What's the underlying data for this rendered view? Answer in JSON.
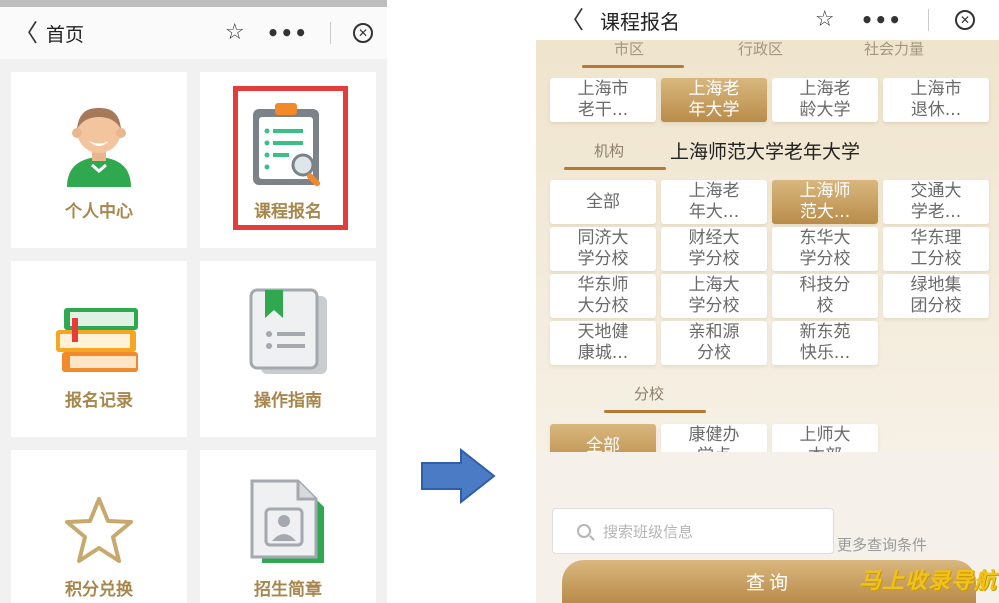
{
  "left": {
    "nav": {
      "back": "〈",
      "title": "首页",
      "star": "☆",
      "more": "•••",
      "close": "✕"
    },
    "tiles": [
      {
        "label": "个人中心",
        "icon": "person-avatar-icon"
      },
      {
        "label": "课程报名",
        "icon": "clipboard-search-icon",
        "highlighted": true
      },
      {
        "label": "报名记录",
        "icon": "book-stack-icon"
      },
      {
        "label": "操作指南",
        "icon": "bookmark-document-icon"
      },
      {
        "label": "积分兑换",
        "icon": "star-outline-icon"
      },
      {
        "label": "招生简章",
        "icon": "profile-document-icon"
      }
    ],
    "highlight_color": "#e43b3b",
    "label_color": "#a8874c"
  },
  "arrow_color": "#4a7bc4",
  "right": {
    "nav": {
      "back": "〈",
      "title": "课程报名",
      "star": "☆",
      "more": "•••",
      "close": "✕"
    },
    "category_tabs": [
      "市区",
      "行政区",
      "社会力量"
    ],
    "category_chips": [
      "上海市\n老干...",
      "上海老\n年大学",
      "上海老\n龄大学",
      "上海市\n退休..."
    ],
    "category_selected": "上海老\n年大学",
    "org_label": "机构",
    "org_selected_name": "上海师范大学老年大学",
    "org_chips": [
      "全部",
      "上海老\n年大...",
      "上海师\n范大...",
      "交通大\n学老...",
      "同济大\n学分校",
      "财经大\n学分校",
      "东华大\n学分校",
      "华东理\n工分校",
      "华东师\n大分校",
      "上海大\n学分校",
      "科技分\n校",
      "绿地集\n团分校",
      "天地健\n康城...",
      "亲和源\n分校",
      "新东苑\n快乐..."
    ],
    "org_selected": "上海师\n范大...",
    "branch_label": "分校",
    "branch_chips": [
      "全部",
      "康健办\n学点",
      "上师大\n本部"
    ],
    "branch_selected": "全部",
    "search_placeholder": "搜索班级信息",
    "more_conditions": "更多查询条件",
    "query_button": "查询",
    "watermark": "马上收录导航",
    "accent": "#b98c4a"
  }
}
